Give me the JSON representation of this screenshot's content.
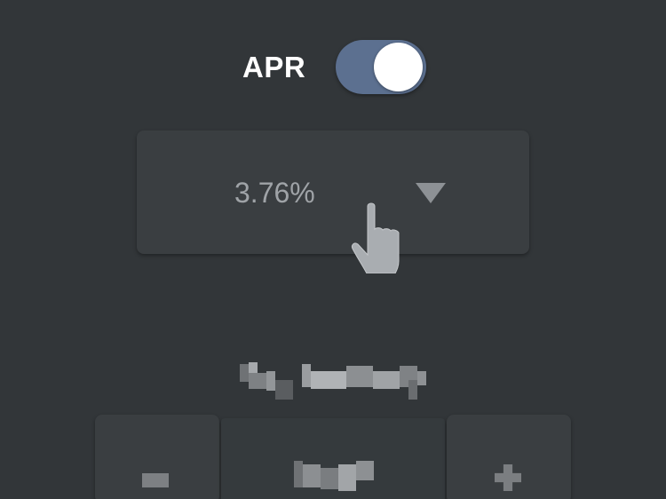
{
  "toggle": {
    "label": "APR",
    "state": "on",
    "accent_color": "#5c7090"
  },
  "dropdown": {
    "selected_value": "3.76%",
    "arrow_icon": "caret-down-icon"
  },
  "cursor": {
    "icon": "pointer-hand-icon"
  },
  "colors": {
    "background": "#323639",
    "panel": "#3a3e41",
    "text_primary": "#ffffff",
    "text_muted": "#9fa3a7"
  }
}
